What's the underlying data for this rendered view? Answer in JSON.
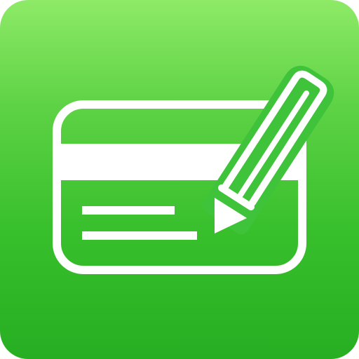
{
  "app_icon": {
    "name": "expense-tracker-card-with-pencil",
    "glyph_color": "#FFFFFF",
    "gradient": {
      "top": "#8EEA67",
      "mid1": "#5DD245",
      "mid2": "#37BF2C",
      "bottom": "#27AE22"
    },
    "elements": {
      "card": "credit-card-icon",
      "stripe": "magnetic-stripe",
      "lines": "text-lines",
      "pencil": "pencil-icon"
    }
  }
}
